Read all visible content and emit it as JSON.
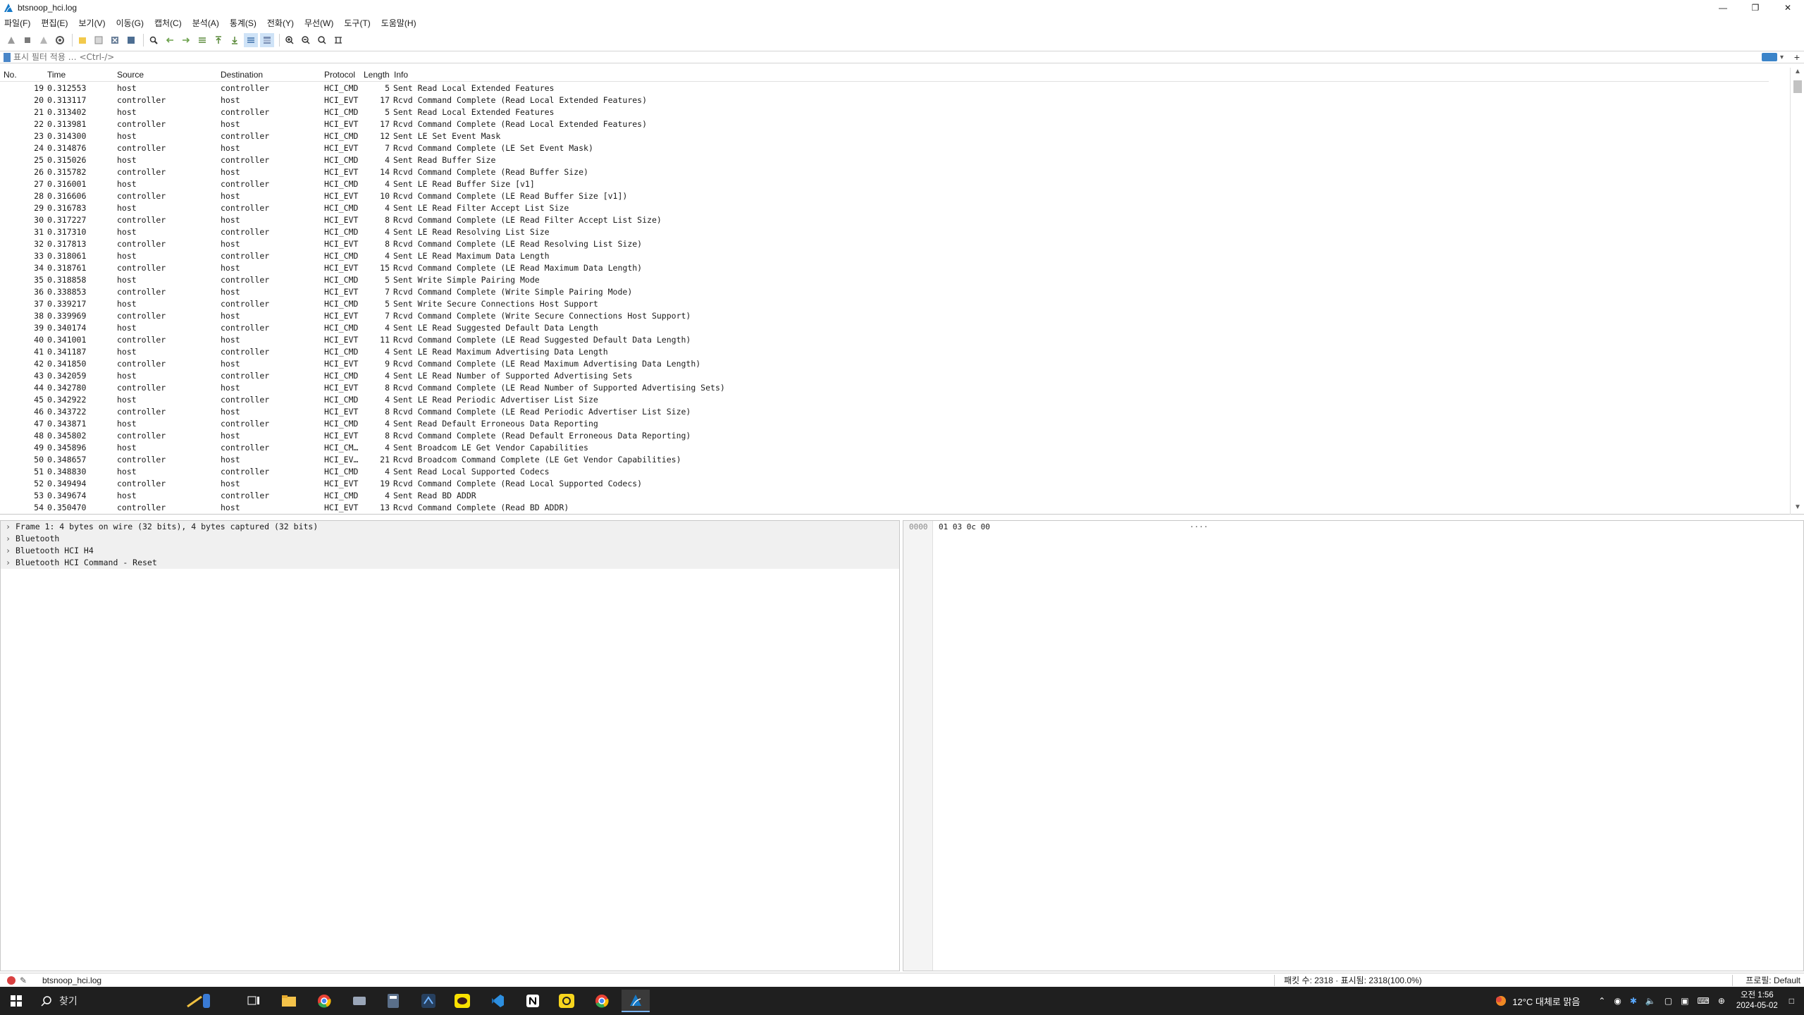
{
  "window": {
    "title": "btsnoop_hci.log"
  },
  "menu": [
    "파일(F)",
    "편집(E)",
    "보기(V)",
    "이동(G)",
    "캡처(C)",
    "분석(A)",
    "통계(S)",
    "전화(Y)",
    "무선(W)",
    "도구(T)",
    "도움말(H)"
  ],
  "filter": {
    "placeholder": "표시 필터 적용 … <Ctrl-/>"
  },
  "packet_list": {
    "columns": {
      "no": "No.",
      "time": "Time",
      "source": "Source",
      "destination": "Destination",
      "protocol": "Protocol",
      "length": "Length",
      "info": "Info"
    },
    "rows": [
      {
        "no": "19",
        "time": "0.312553",
        "src": "host",
        "dst": "controller",
        "proto": "HCI_CMD",
        "len": "5",
        "info": "Sent Read Local Extended Features"
      },
      {
        "no": "20",
        "time": "0.313117",
        "src": "controller",
        "dst": "host",
        "proto": "HCI_EVT",
        "len": "17",
        "info": "Rcvd Command Complete (Read Local Extended Features)"
      },
      {
        "no": "21",
        "time": "0.313402",
        "src": "host",
        "dst": "controller",
        "proto": "HCI_CMD",
        "len": "5",
        "info": "Sent Read Local Extended Features"
      },
      {
        "no": "22",
        "time": "0.313981",
        "src": "controller",
        "dst": "host",
        "proto": "HCI_EVT",
        "len": "17",
        "info": "Rcvd Command Complete (Read Local Extended Features)"
      },
      {
        "no": "23",
        "time": "0.314300",
        "src": "host",
        "dst": "controller",
        "proto": "HCI_CMD",
        "len": "12",
        "info": "Sent LE Set Event Mask"
      },
      {
        "no": "24",
        "time": "0.314876",
        "src": "controller",
        "dst": "host",
        "proto": "HCI_EVT",
        "len": "7",
        "info": "Rcvd Command Complete (LE Set Event Mask)"
      },
      {
        "no": "25",
        "time": "0.315026",
        "src": "host",
        "dst": "controller",
        "proto": "HCI_CMD",
        "len": "4",
        "info": "Sent Read Buffer Size"
      },
      {
        "no": "26",
        "time": "0.315782",
        "src": "controller",
        "dst": "host",
        "proto": "HCI_EVT",
        "len": "14",
        "info": "Rcvd Command Complete (Read Buffer Size)"
      },
      {
        "no": "27",
        "time": "0.316001",
        "src": "host",
        "dst": "controller",
        "proto": "HCI_CMD",
        "len": "4",
        "info": "Sent LE Read Buffer Size [v1]"
      },
      {
        "no": "28",
        "time": "0.316606",
        "src": "controller",
        "dst": "host",
        "proto": "HCI_EVT",
        "len": "10",
        "info": "Rcvd Command Complete (LE Read Buffer Size [v1])"
      },
      {
        "no": "29",
        "time": "0.316783",
        "src": "host",
        "dst": "controller",
        "proto": "HCI_CMD",
        "len": "4",
        "info": "Sent LE Read Filter Accept List Size"
      },
      {
        "no": "30",
        "time": "0.317227",
        "src": "controller",
        "dst": "host",
        "proto": "HCI_EVT",
        "len": "8",
        "info": "Rcvd Command Complete (LE Read Filter Accept List Size)"
      },
      {
        "no": "31",
        "time": "0.317310",
        "src": "host",
        "dst": "controller",
        "proto": "HCI_CMD",
        "len": "4",
        "info": "Sent LE Read Resolving List Size"
      },
      {
        "no": "32",
        "time": "0.317813",
        "src": "controller",
        "dst": "host",
        "proto": "HCI_EVT",
        "len": "8",
        "info": "Rcvd Command Complete (LE Read Resolving List Size)"
      },
      {
        "no": "33",
        "time": "0.318061",
        "src": "host",
        "dst": "controller",
        "proto": "HCI_CMD",
        "len": "4",
        "info": "Sent LE Read Maximum Data Length"
      },
      {
        "no": "34",
        "time": "0.318761",
        "src": "controller",
        "dst": "host",
        "proto": "HCI_EVT",
        "len": "15",
        "info": "Rcvd Command Complete (LE Read Maximum Data Length)"
      },
      {
        "no": "35",
        "time": "0.318858",
        "src": "host",
        "dst": "controller",
        "proto": "HCI_CMD",
        "len": "5",
        "info": "Sent Write Simple Pairing Mode"
      },
      {
        "no": "36",
        "time": "0.338853",
        "src": "controller",
        "dst": "host",
        "proto": "HCI_EVT",
        "len": "7",
        "info": "Rcvd Command Complete (Write Simple Pairing Mode)"
      },
      {
        "no": "37",
        "time": "0.339217",
        "src": "host",
        "dst": "controller",
        "proto": "HCI_CMD",
        "len": "5",
        "info": "Sent Write Secure Connections Host Support"
      },
      {
        "no": "38",
        "time": "0.339969",
        "src": "controller",
        "dst": "host",
        "proto": "HCI_EVT",
        "len": "7",
        "info": "Rcvd Command Complete (Write Secure Connections Host Support)"
      },
      {
        "no": "39",
        "time": "0.340174",
        "src": "host",
        "dst": "controller",
        "proto": "HCI_CMD",
        "len": "4",
        "info": "Sent LE Read Suggested Default Data Length"
      },
      {
        "no": "40",
        "time": "0.341001",
        "src": "controller",
        "dst": "host",
        "proto": "HCI_EVT",
        "len": "11",
        "info": "Rcvd Command Complete (LE Read Suggested Default Data Length)"
      },
      {
        "no": "41",
        "time": "0.341187",
        "src": "host",
        "dst": "controller",
        "proto": "HCI_CMD",
        "len": "4",
        "info": "Sent LE Read Maximum Advertising Data Length"
      },
      {
        "no": "42",
        "time": "0.341850",
        "src": "controller",
        "dst": "host",
        "proto": "HCI_EVT",
        "len": "9",
        "info": "Rcvd Command Complete (LE Read Maximum Advertising Data Length)"
      },
      {
        "no": "43",
        "time": "0.342059",
        "src": "host",
        "dst": "controller",
        "proto": "HCI_CMD",
        "len": "4",
        "info": "Sent LE Read Number of Supported Advertising Sets"
      },
      {
        "no": "44",
        "time": "0.342780",
        "src": "controller",
        "dst": "host",
        "proto": "HCI_EVT",
        "len": "8",
        "info": "Rcvd Command Complete (LE Read Number of Supported Advertising Sets)"
      },
      {
        "no": "45",
        "time": "0.342922",
        "src": "host",
        "dst": "controller",
        "proto": "HCI_CMD",
        "len": "4",
        "info": "Sent LE Read Periodic Advertiser List Size"
      },
      {
        "no": "46",
        "time": "0.343722",
        "src": "controller",
        "dst": "host",
        "proto": "HCI_EVT",
        "len": "8",
        "info": "Rcvd Command Complete (LE Read Periodic Advertiser List Size)"
      },
      {
        "no": "47",
        "time": "0.343871",
        "src": "host",
        "dst": "controller",
        "proto": "HCI_CMD",
        "len": "4",
        "info": "Sent Read Default Erroneous Data Reporting"
      },
      {
        "no": "48",
        "time": "0.345802",
        "src": "controller",
        "dst": "host",
        "proto": "HCI_EVT",
        "len": "8",
        "info": "Rcvd Command Complete (Read Default Erroneous Data Reporting)"
      },
      {
        "no": "49",
        "time": "0.345896",
        "src": "host",
        "dst": "controller",
        "proto": "HCI_CM…",
        "len": "4",
        "info": "Sent Broadcom LE Get Vendor Capabilities"
      },
      {
        "no": "50",
        "time": "0.348657",
        "src": "controller",
        "dst": "host",
        "proto": "HCI_EV…",
        "len": "21",
        "info": "Rcvd Broadcom Command Complete (LE Get Vendor Capabilities)"
      },
      {
        "no": "51",
        "time": "0.348830",
        "src": "host",
        "dst": "controller",
        "proto": "HCI_CMD",
        "len": "4",
        "info": "Sent Read Local Supported Codecs"
      },
      {
        "no": "52",
        "time": "0.349494",
        "src": "controller",
        "dst": "host",
        "proto": "HCI_EVT",
        "len": "19",
        "info": "Rcvd Command Complete (Read Local Supported Codecs)"
      },
      {
        "no": "53",
        "time": "0.349674",
        "src": "host",
        "dst": "controller",
        "proto": "HCI_CMD",
        "len": "4",
        "info": "Sent Read BD ADDR"
      },
      {
        "no": "54",
        "time": "0.350470",
        "src": "controller",
        "dst": "host",
        "proto": "HCI_EVT",
        "len": "13",
        "info": "Rcvd Command Complete (Read BD ADDR)"
      }
    ]
  },
  "details": [
    "Frame 1: 4 bytes on wire (32 bits), 4 bytes captured (32 bits)",
    "Bluetooth",
    "Bluetooth HCI H4",
    "Bluetooth HCI Command - Reset"
  ],
  "bytes": {
    "offset": "0000",
    "hex": "01 03 0c 00",
    "ascii": "····"
  },
  "status": {
    "file": "btsnoop_hci.log",
    "counts": "패킷 수: 2318 · 표시됨: 2318(100.0%)",
    "profile": "프로필: Default"
  },
  "taskbar": {
    "search": "찾기",
    "weather": "12°C 대체로 맑음",
    "time": "오전 1:56",
    "date": "2024-05-02"
  },
  "colors": {
    "accent": "#3b84c9",
    "taskbar": "#1f1f1f",
    "selected_detail": "#f0f0f0"
  }
}
